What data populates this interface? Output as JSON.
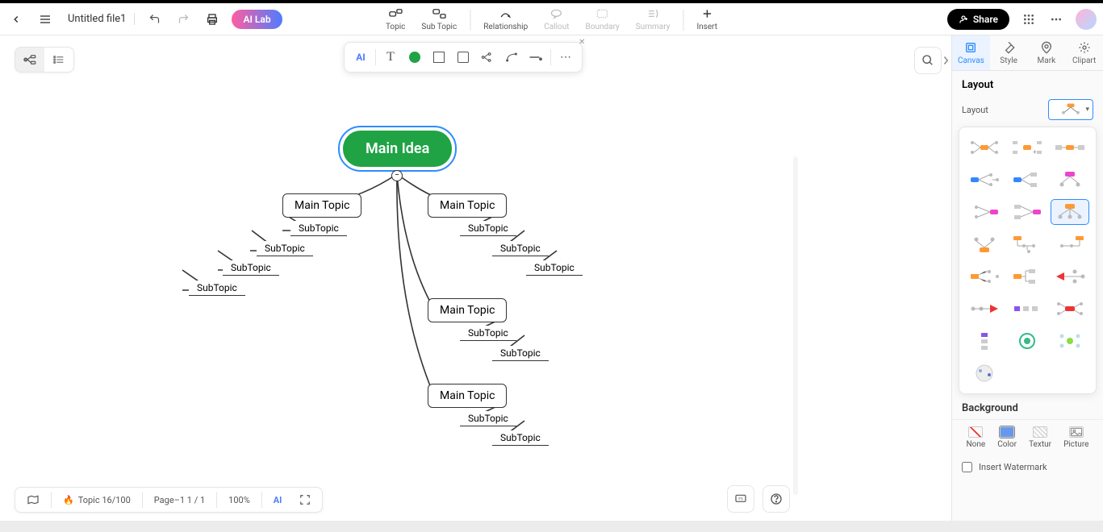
{
  "header": {
    "file_title": "Untitled file1",
    "ai_lab": "AI Lab",
    "center_items": [
      {
        "label": "Topic",
        "disabled": false
      },
      {
        "label": "Sub Topic",
        "disabled": false
      },
      {
        "label": "Relationship",
        "disabled": false
      },
      {
        "label": "Callout",
        "disabled": true
      },
      {
        "label": "Boundary",
        "disabled": true
      },
      {
        "label": "Summary",
        "disabled": true
      },
      {
        "label": "Insert",
        "disabled": false
      }
    ],
    "share": "Share"
  },
  "float_toolbar": {
    "ai": "AI"
  },
  "mindmap": {
    "main_idea": "Main Idea",
    "topics": [
      {
        "label": "Main Topic",
        "subs": [
          "SubTopic",
          "SubTopic",
          "SubTopic",
          "SubTopic"
        ]
      },
      {
        "label": "Main Topic",
        "subs": [
          "SubTopic",
          "SubTopic",
          "SubTopic"
        ]
      },
      {
        "label": "Main Topic",
        "subs": [
          "SubTopic",
          "SubTopic"
        ]
      },
      {
        "label": "Main Topic",
        "subs": [
          "SubTopic",
          "SubTopic"
        ]
      }
    ]
  },
  "right_panel": {
    "tabs": [
      "Canvas",
      "Style",
      "Mark",
      "Clipart"
    ],
    "section_layout_title": "Layout",
    "layout_label": "Layout",
    "background_label": "Background",
    "bg_items": [
      "None",
      "Color",
      "Textur",
      "Picture"
    ],
    "watermark": "Insert Watermark"
  },
  "bottom": {
    "topic_count": "Topic 16/100",
    "page": "Page–1  1 / 1",
    "zoom": "100%",
    "ai": "AI"
  }
}
